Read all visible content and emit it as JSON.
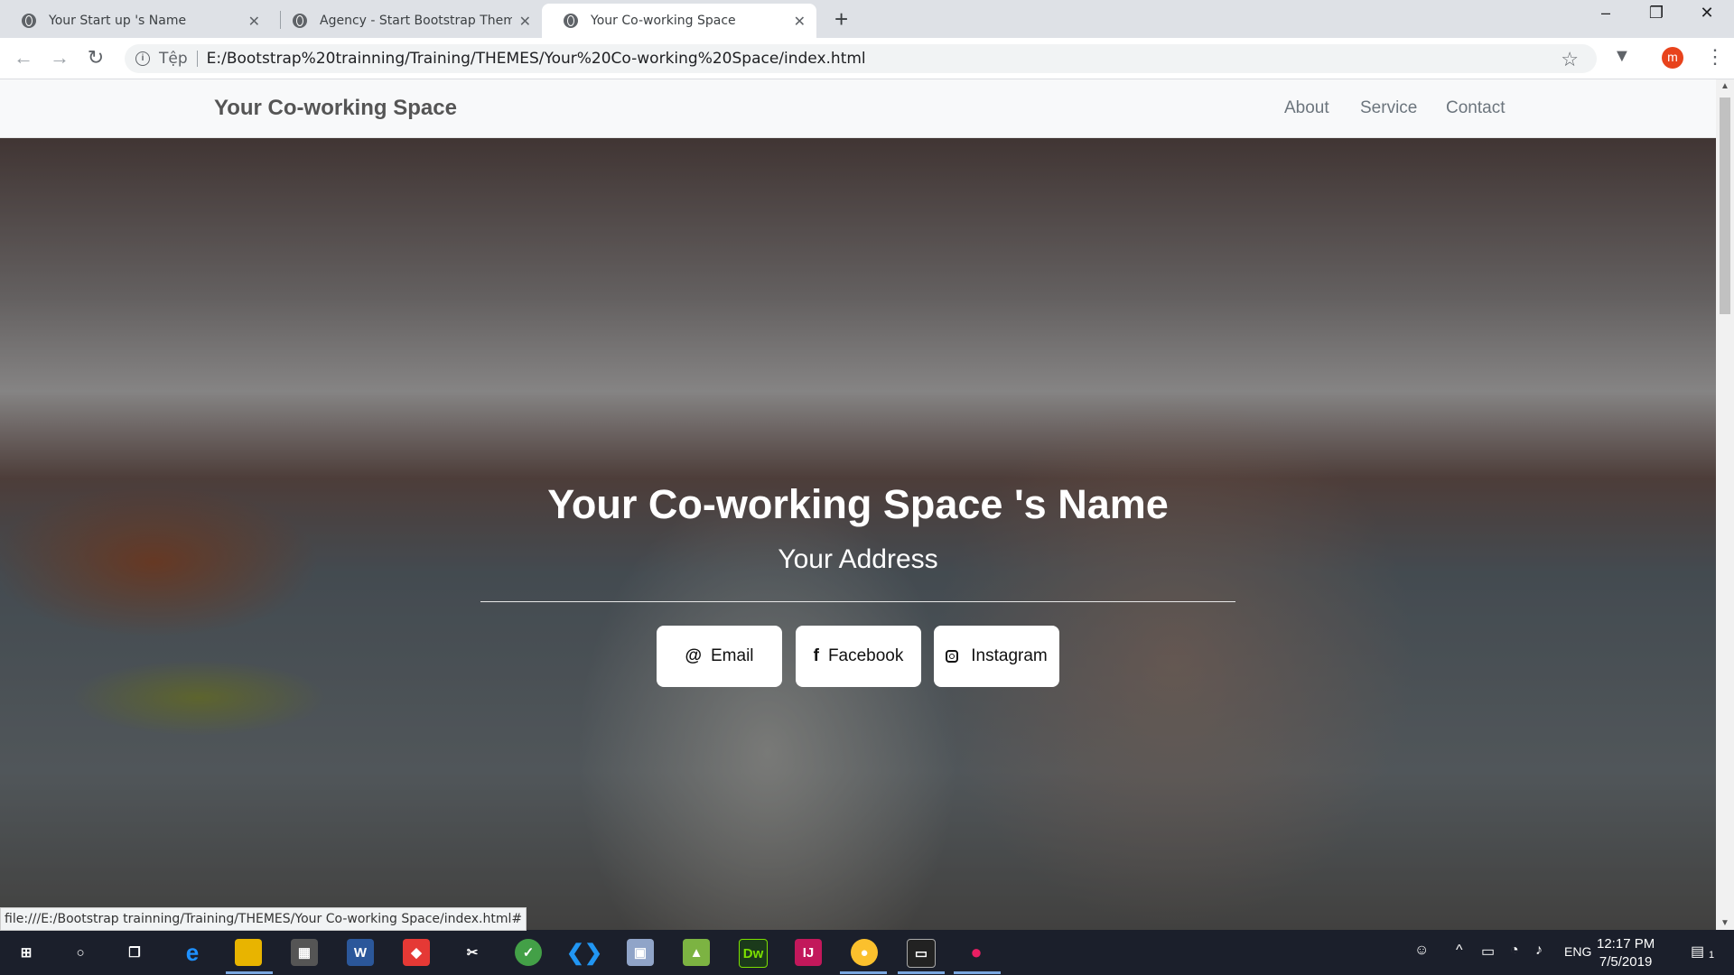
{
  "browser": {
    "tabs": [
      {
        "label": "Your Start up 's Name",
        "active": false
      },
      {
        "label": "Agency - Start Bootstrap Theme",
        "active": false
      },
      {
        "label": "Your Co-working Space",
        "active": true
      }
    ],
    "new_tab_symbol": "+",
    "address": {
      "scheme_label": "Tệp",
      "url": "E:/Bootstrap%20trainning/Training/THEMES/Your%20Co-working%20Space/index.html"
    },
    "profile_initial": "m",
    "status_url": "file:///E:/Bootstrap trainning/Training/THEMES/Your Co-working Space/index.html#"
  },
  "site": {
    "brand": "Your Co-working Space",
    "nav": [
      "About",
      "Service",
      "Contact"
    ]
  },
  "hero": {
    "title": "Your Co-working Space 's Name",
    "address": "Your Address",
    "buttons": [
      {
        "label": "Email",
        "icon": "at-icon",
        "glyph": "@"
      },
      {
        "label": "Facebook",
        "icon": "facebook-icon",
        "glyph": "f"
      },
      {
        "label": "Instagram",
        "icon": "instagram-icon",
        "glyph": ""
      }
    ]
  },
  "taskbar": {
    "language": "ENG",
    "time": "12:17 PM",
    "date": "7/5/2019",
    "notification_count": "1",
    "apps": [
      "start",
      "search",
      "task-view",
      "edge",
      "file-explorer",
      "store",
      "word",
      "app-red",
      "tools",
      "app-green",
      "vscode",
      "app-cube",
      "app-image",
      "dreamweaver",
      "intellij",
      "chrome",
      "terminal",
      "app-pin"
    ]
  },
  "colors": {
    "tabbar_bg": "#dee1e6",
    "navbar_bg": "#f8f9fa",
    "taskbar_bg": "#1b1f2b",
    "avatar_bg": "#e8431c",
    "active_app_underline": "#7aa7e0"
  }
}
